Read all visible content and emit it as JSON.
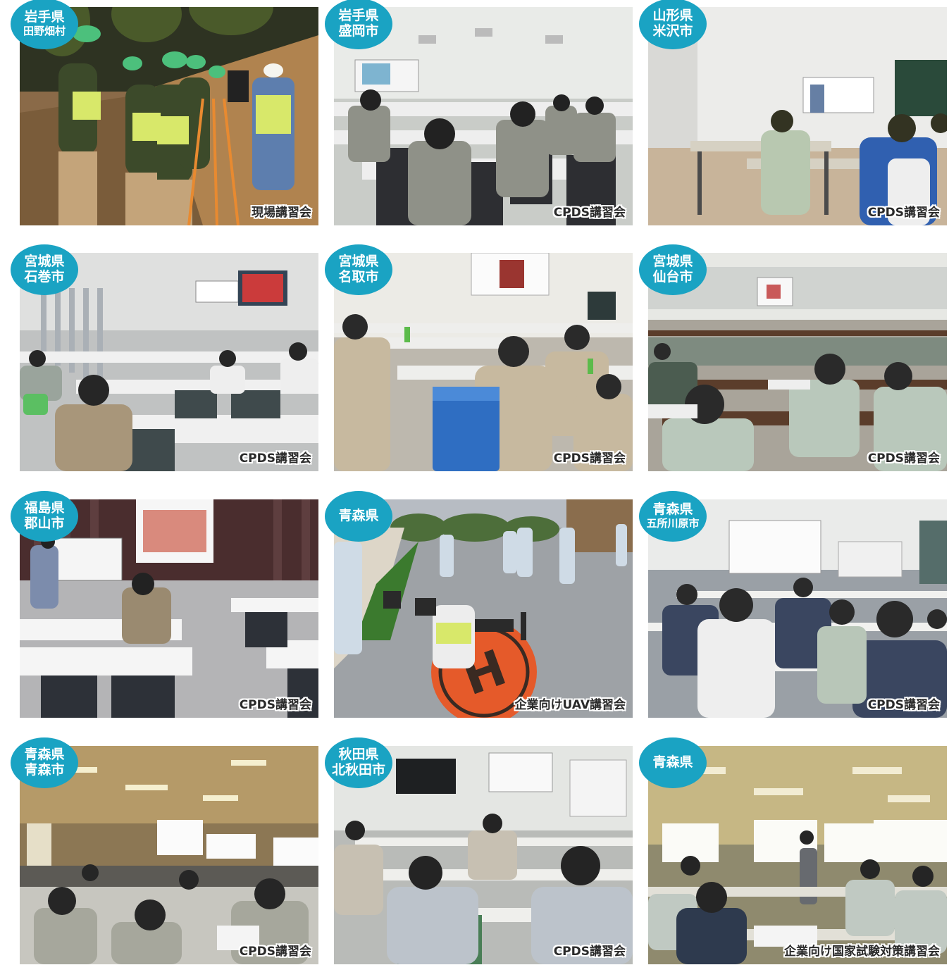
{
  "photos": [
    {
      "location_line1": "岩手県",
      "location_line2": "田野畑村",
      "caption": "現場講習会",
      "scene": "outdoor-survey"
    },
    {
      "location_line1": "岩手県",
      "location_line2": "盛岡市",
      "caption": "CPDS講習会",
      "scene": "lecture-hall"
    },
    {
      "location_line1": "山形県",
      "location_line2": "米沢市",
      "caption": "CPDS講習会",
      "scene": "bright-room"
    },
    {
      "location_line1": "宮城県",
      "location_line2": "石巻市",
      "caption": "CPDS講習会",
      "scene": "lecture-hall"
    },
    {
      "location_line1": "宮城県",
      "location_line2": "名取市",
      "caption": "CPDS講習会",
      "scene": "cooler-room"
    },
    {
      "location_line1": "宮城県",
      "location_line2": "仙台市",
      "caption": "CPDS講習会",
      "scene": "large-hall"
    },
    {
      "location_line1": "福島県",
      "location_line2": "郡山市",
      "caption": "CPDS講習会",
      "scene": "curtain-room"
    },
    {
      "location_line1": "青森県",
      "location_line2": "",
      "caption": "企業向けUAV講習会",
      "scene": "uav-outdoor"
    },
    {
      "location_line1": "青森県",
      "location_line2": "五所川原市",
      "caption": "CPDS講習会",
      "scene": "large-hall"
    },
    {
      "location_line1": "青森県",
      "location_line2": "青森市",
      "caption": "CPDS講習会",
      "scene": "wood-hall"
    },
    {
      "location_line1": "秋田県",
      "location_line2": "北秋田市",
      "caption": "CPDS講習会",
      "scene": "monitor-room"
    },
    {
      "location_line1": "青森県",
      "location_line2": "",
      "caption": "企業向け国家試験対策講習会",
      "scene": "whiteboard-room"
    }
  ],
  "colors": {
    "badge": "#1aa3c3",
    "badge_text": "#ffffff",
    "caption_text": "#2a2a2a"
  }
}
